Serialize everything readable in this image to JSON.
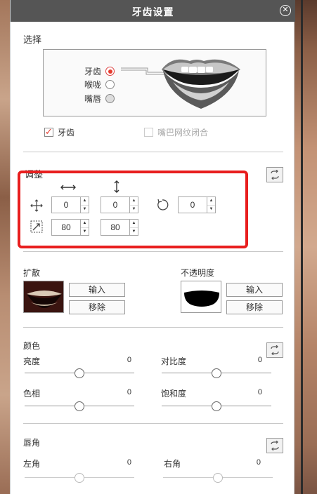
{
  "window": {
    "title": "牙齿设置"
  },
  "select_section": {
    "label": "选择",
    "options": [
      {
        "label": "牙齿",
        "selected": true
      },
      {
        "label": "喉咙",
        "selected": false
      },
      {
        "label": "嘴唇",
        "selected": false
      }
    ],
    "teeth_checkbox": {
      "label": "牙齿",
      "checked": true
    },
    "mouth_closed_checkbox": {
      "label": "嘴巴网纹闭合",
      "checked": false
    }
  },
  "adjust_section": {
    "label": "调整",
    "move_x": "0",
    "move_y": "0",
    "rotate": "0",
    "scale_x": "80",
    "scale_y": "80"
  },
  "diffuse_section": {
    "label": "扩散",
    "import_label": "输入",
    "remove_label": "移除"
  },
  "opacity_section": {
    "label": "不透明度",
    "import_label": "输入",
    "remove_label": "移除"
  },
  "color_section": {
    "label": "颜色",
    "brightness": {
      "label": "亮度",
      "value": "0",
      "level": 0.5
    },
    "contrast": {
      "label": "对比度",
      "value": "0",
      "level": 0.5
    },
    "hue": {
      "label": "色相",
      "value": "0",
      "level": 0.5
    },
    "saturation": {
      "label": "饱和度",
      "value": "0",
      "level": 0.5
    }
  },
  "lip_corner_section": {
    "label": "唇角",
    "left": {
      "label": "左角",
      "value": "0",
      "level": 0.5
    },
    "right": {
      "label": "右角",
      "value": "0",
      "level": 0.5
    }
  },
  "colors": {
    "accent": "#e63a2e",
    "highlight": "#e81e1e",
    "titlebar": "#555555"
  }
}
